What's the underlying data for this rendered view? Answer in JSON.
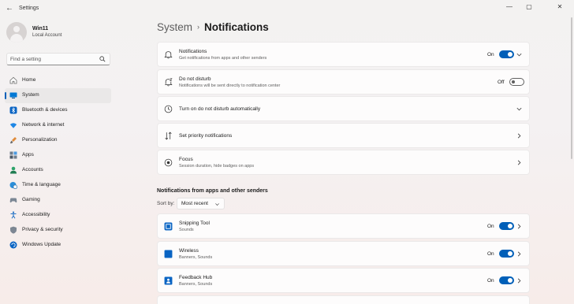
{
  "window": {
    "title": "Settings",
    "back_glyph": "←",
    "minimize_glyph": "—",
    "maximize_glyph": "▢",
    "close_glyph": "✕"
  },
  "profile": {
    "name": "Win11",
    "account_type": "Local Account"
  },
  "search": {
    "placeholder": "Find a setting"
  },
  "sidebar": {
    "items": [
      {
        "label": "Home",
        "icon": "home-icon",
        "active": false
      },
      {
        "label": "System",
        "icon": "system-icon",
        "active": true
      },
      {
        "label": "Bluetooth & devices",
        "icon": "bluetooth-icon",
        "active": false
      },
      {
        "label": "Network & internet",
        "icon": "wifi-icon",
        "active": false
      },
      {
        "label": "Personalization",
        "icon": "brush-icon",
        "active": false
      },
      {
        "label": "Apps",
        "icon": "apps-icon",
        "active": false
      },
      {
        "label": "Accounts",
        "icon": "accounts-icon",
        "active": false
      },
      {
        "label": "Time & language",
        "icon": "globe-clock-icon",
        "active": false
      },
      {
        "label": "Gaming",
        "icon": "gamepad-icon",
        "active": false
      },
      {
        "label": "Accessibility",
        "icon": "accessibility-icon",
        "active": false
      },
      {
        "label": "Privacy & security",
        "icon": "shield-icon",
        "active": false
      },
      {
        "label": "Windows Update",
        "icon": "update-icon",
        "active": false
      }
    ]
  },
  "breadcrumb": {
    "parent": "System",
    "separator": "›",
    "current": "Notifications"
  },
  "settings": {
    "notifications": {
      "title": "Notifications",
      "subtitle": "Get notifications from apps and other senders",
      "state_label": "On",
      "on": true
    },
    "dnd": {
      "title": "Do not disturb",
      "subtitle": "Notifications will be sent directly to notification center",
      "state_label": "Off",
      "on": false
    },
    "auto_dnd": {
      "title": "Turn on do not disturb automatically"
    },
    "priority": {
      "title": "Set priority notifications"
    },
    "focus": {
      "title": "Focus",
      "subtitle": "Session duration, hide badges on apps"
    }
  },
  "apps_section": {
    "title": "Notifications from apps and other senders",
    "sort_label": "Sort by:",
    "sort_value": "Most recent",
    "apps": [
      {
        "name": "Snipping Tool",
        "subtitle": "Sounds",
        "state_label": "On",
        "on": true
      },
      {
        "name": "Wireless",
        "subtitle": "Banners, Sounds",
        "state_label": "On",
        "on": true
      },
      {
        "name": "Feedback Hub",
        "subtitle": "Banners, Sounds",
        "state_label": "On",
        "on": true
      }
    ]
  },
  "colors": {
    "accent": "#005fb8",
    "card_bg": "#fdfcfc",
    "text": "#1b1b1b"
  }
}
